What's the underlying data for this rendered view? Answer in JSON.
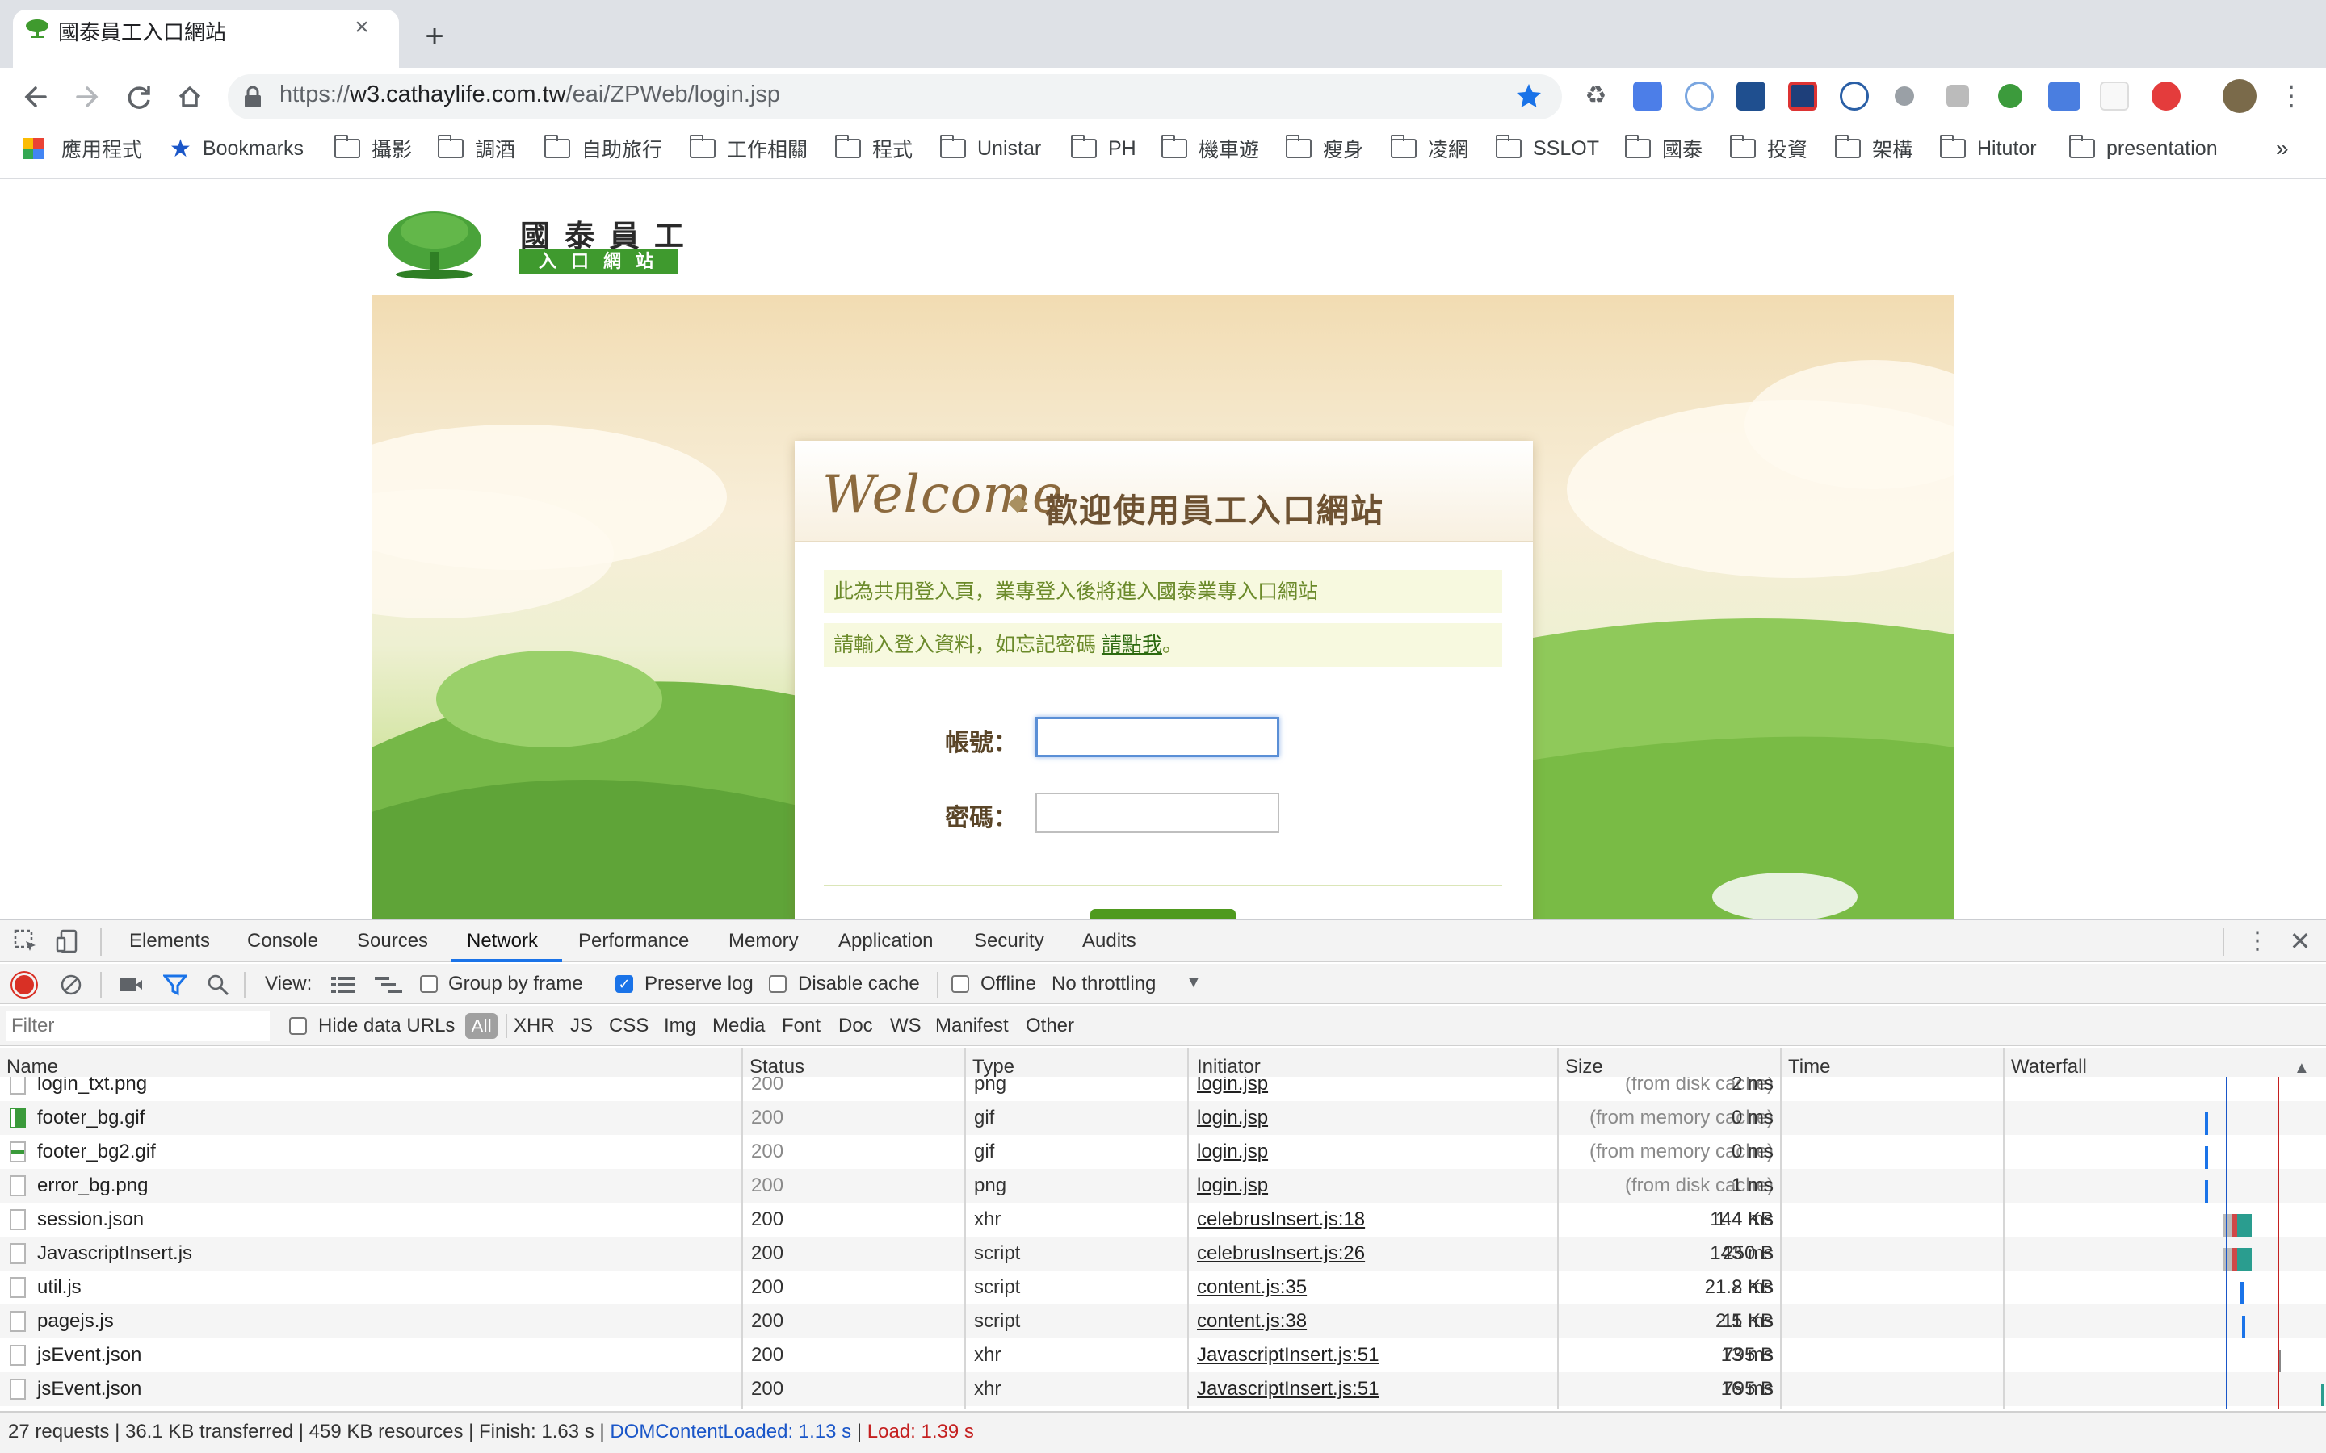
{
  "browser": {
    "tab_title": "國泰員工入口網站",
    "tab_close": "×",
    "new_tab": "+",
    "url_scheme": "https://",
    "url_host": "w3.cathaylife.com.tw",
    "url_path": "/eai/ZPWeb/login.jsp",
    "bookmarks": [
      "應用程式",
      "Bookmarks",
      "攝影",
      "調酒",
      "自助旅行",
      "工作相關",
      "程式",
      "Unistar",
      "PH",
      "機車遊",
      "瘦身",
      "凌網",
      "SSLOT",
      "國泰",
      "投資",
      "架構",
      "Hitutor",
      "presentation"
    ],
    "bookmarks_more": "»"
  },
  "page": {
    "logo_line1": "國 泰 員 工",
    "logo_line2": "入 口 網 站",
    "welcome_script": "Welcome",
    "welcome_text": "歡迎使用員工入口網站",
    "notice1": "此為共用登入頁，業專登入後將進入國泰業專入口網站",
    "notice2_pre": "請輸入登入資料，如忘記密碼 ",
    "notice2_link": "請點我",
    "notice2_post": "。",
    "account_label": "帳號：",
    "password_label": "密碼：",
    "account_value": "",
    "password_value": ""
  },
  "devtools": {
    "tabs": [
      "Elements",
      "Console",
      "Sources",
      "Network",
      "Performance",
      "Memory",
      "Application",
      "Security",
      "Audits"
    ],
    "active_tab": "Network",
    "toolbar": {
      "view_label": "View:",
      "group_by_frame": "Group by frame",
      "preserve_log": "Preserve log",
      "disable_cache": "Disable cache",
      "offline": "Offline",
      "throttling": "No throttling"
    },
    "filter": {
      "placeholder": "Filter",
      "hide_data_urls": "Hide data URLs",
      "types": [
        "All",
        "XHR",
        "JS",
        "CSS",
        "Img",
        "Media",
        "Font",
        "Doc",
        "WS",
        "Manifest",
        "Other"
      ]
    },
    "columns": [
      "Name",
      "Status",
      "Type",
      "Initiator",
      "Size",
      "Time",
      "Waterfall"
    ],
    "rows": [
      {
        "name": "login_txt.png",
        "status": "200",
        "type": "png",
        "initiator": "login.jsp",
        "size": "(from disk cache)",
        "time": "2 ms"
      },
      {
        "name": "footer_bg.gif",
        "status": "200",
        "type": "gif",
        "initiator": "login.jsp",
        "size": "(from memory cache)",
        "time": "0 ms"
      },
      {
        "name": "footer_bg2.gif",
        "status": "200",
        "type": "gif",
        "initiator": "login.jsp",
        "size": "(from memory cache)",
        "time": "0 ms"
      },
      {
        "name": "error_bg.png",
        "status": "200",
        "type": "png",
        "initiator": "login.jsp",
        "size": "(from disk cache)",
        "time": "1 ms"
      },
      {
        "name": "session.json",
        "status": "200",
        "type": "xhr",
        "initiator": "celebrusInsert.js:18",
        "size": "1.4 KB",
        "time": "144 ms"
      },
      {
        "name": "JavascriptInsert.js",
        "status": "200",
        "type": "script",
        "initiator": "celebrusInsert.js:26",
        "size": "250 B",
        "time": "143 ms"
      },
      {
        "name": "util.js",
        "status": "200",
        "type": "script",
        "initiator": "content.js:35",
        "size": "21.2 KB",
        "time": "8 ms"
      },
      {
        "name": "pagejs.js",
        "status": "200",
        "type": "script",
        "initiator": "content.js:38",
        "size": "2.5 KB",
        "time": "11 ms"
      },
      {
        "name": "jsEvent.json",
        "status": "200",
        "type": "xhr",
        "initiator": "JavascriptInsert.js:51",
        "size": "795 B",
        "time": "13 ms"
      },
      {
        "name": "jsEvent.json",
        "status": "200",
        "type": "xhr",
        "initiator": "JavascriptInsert.js:51",
        "size": "795 B",
        "time": "16 ms"
      }
    ],
    "summary": {
      "main": "27 requests | 36.1 KB transferred | 459 KB resources | Finish: 1.63 s | ",
      "dom": "DOMContentLoaded: 1.13 s",
      "sep": " | ",
      "load": "Load: 1.39 s"
    }
  },
  "colors": {
    "dom_blue": "#1a56c8",
    "load_red": "#c41f1f",
    "accent_green": "#4f9a1e"
  }
}
